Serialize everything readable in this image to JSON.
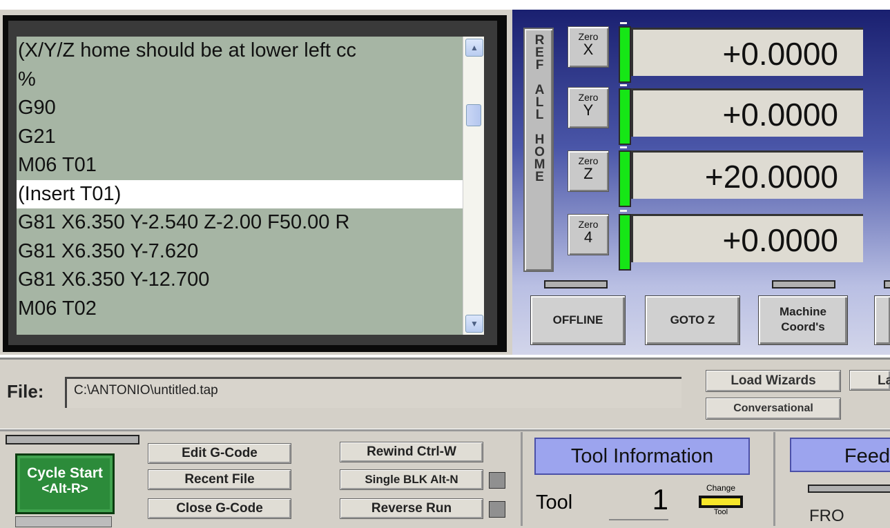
{
  "gcode": {
    "lines": [
      "(X/Y/Z home should be at lower left cc",
      "%",
      "G90",
      "G21",
      "M06 T01",
      "(Insert T01)",
      "G81 X6.350 Y-2.540 Z-2.00 F50.00 R",
      "G81 X6.350 Y-7.620",
      "G81 X6.350 Y-12.700",
      "M06 T02"
    ],
    "selected_index": 5,
    "scroll_up_icon": "up-arrow-icon",
    "scroll_down_icon": "down-arrow-icon"
  },
  "dro": {
    "ref_all_home": "REF ALL HOME",
    "axes": [
      {
        "zero_label": "Zero",
        "axis": "X",
        "value": "+0.0000"
      },
      {
        "zero_label": "Zero",
        "axis": "Y",
        "value": "+0.0000"
      },
      {
        "zero_label": "Zero",
        "axis": "Z",
        "value": "+20.0000"
      },
      {
        "zero_label": "Zero",
        "axis": "4",
        "value": "+0.0000"
      }
    ],
    "buttons": {
      "offline": "OFFLINE",
      "goto_z": "GOTO Z",
      "machine_coords_1": "Machine",
      "machine_coords_2": "Coord's"
    }
  },
  "file": {
    "label": "File:",
    "path": "C:\\ANTONIO\\untitled.tap"
  },
  "wizards": {
    "load_wizards": "Load Wizards",
    "last": "Las",
    "conversational": "Conversational"
  },
  "controls": {
    "cycle_start_1": "Cycle Start",
    "cycle_start_2": "<Alt-R>",
    "edit_gcode": "Edit G-Code",
    "recent_file": "Recent File",
    "close_gcode": "Close G-Code",
    "rewind": "Rewind Ctrl-W",
    "single_blk": "Single BLK Alt-N",
    "reverse_run": "Reverse Run"
  },
  "tool": {
    "header": "Tool Information",
    "label": "Tool",
    "number": "1",
    "change_1": "Change",
    "change_2": "Tool"
  },
  "feed": {
    "header": "Feed",
    "fro": "FRO"
  },
  "colors": {
    "gcode_bg": "#a6b5a4",
    "led_green": "#16e616",
    "header_blue": "#9ca4ee",
    "cycle_green": "#2c8b3a"
  }
}
